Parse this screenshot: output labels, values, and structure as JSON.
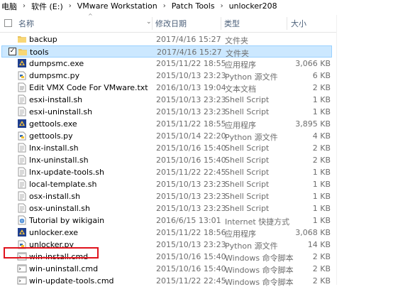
{
  "breadcrumb": [
    "电脑",
    "软件 (E:)",
    "VMware Workstation",
    "Patch Tools",
    "unlocker208"
  ],
  "columns": {
    "name": "名称",
    "date": "修改日期",
    "type": "类型",
    "size": "大小"
  },
  "files": [
    {
      "name": "backup",
      "date": "2017/4/16 15:27",
      "type": "文件夹",
      "size": "",
      "icon": "folder"
    },
    {
      "name": "tools",
      "date": "2017/4/16 15:27",
      "type": "文件夹",
      "size": "",
      "icon": "folder",
      "selected": true
    },
    {
      "name": "dumpsmc.exe",
      "date": "2015/11/22 18:55",
      "type": "应用程序",
      "size": "3,066 KB",
      "icon": "exe"
    },
    {
      "name": "dumpsmc.py",
      "date": "2015/10/13 23:23",
      "type": "Python 源文件",
      "size": "6 KB",
      "icon": "py"
    },
    {
      "name": "Edit VMX Code For VMware.txt",
      "date": "2016/10/13 19:04",
      "type": "文本文档",
      "size": "2 KB",
      "icon": "txt"
    },
    {
      "name": "esxi-install.sh",
      "date": "2015/10/13 23:23",
      "type": "Shell Script",
      "size": "1 KB",
      "icon": "sh"
    },
    {
      "name": "esxi-uninstall.sh",
      "date": "2015/10/13 23:23",
      "type": "Shell Script",
      "size": "1 KB",
      "icon": "sh"
    },
    {
      "name": "gettools.exe",
      "date": "2015/11/22 18:55",
      "type": "应用程序",
      "size": "3,895 KB",
      "icon": "exe"
    },
    {
      "name": "gettools.py",
      "date": "2015/10/14 22:20",
      "type": "Python 源文件",
      "size": "4 KB",
      "icon": "py"
    },
    {
      "name": "lnx-install.sh",
      "date": "2015/10/16 15:40",
      "type": "Shell Script",
      "size": "2 KB",
      "icon": "sh"
    },
    {
      "name": "lnx-uninstall.sh",
      "date": "2015/10/16 15:40",
      "type": "Shell Script",
      "size": "2 KB",
      "icon": "sh"
    },
    {
      "name": "lnx-update-tools.sh",
      "date": "2015/11/22 22:45",
      "type": "Shell Script",
      "size": "1 KB",
      "icon": "sh"
    },
    {
      "name": "local-template.sh",
      "date": "2015/10/13 23:23",
      "type": "Shell Script",
      "size": "1 KB",
      "icon": "sh"
    },
    {
      "name": "osx-install.sh",
      "date": "2015/10/13 23:23",
      "type": "Shell Script",
      "size": "1 KB",
      "icon": "sh"
    },
    {
      "name": "osx-uninstall.sh",
      "date": "2015/10/13 23:23",
      "type": "Shell Script",
      "size": "1 KB",
      "icon": "sh"
    },
    {
      "name": "Tutorial by wikigain",
      "date": "2016/6/15 13:01",
      "type": "Internet 快捷方式",
      "size": "1 KB",
      "icon": "url"
    },
    {
      "name": "unlocker.exe",
      "date": "2015/11/22 18:56",
      "type": "应用程序",
      "size": "3,068 KB",
      "icon": "exe"
    },
    {
      "name": "unlocker.py",
      "date": "2015/10/13 23:23",
      "type": "Python 源文件",
      "size": "14 KB",
      "icon": "py"
    },
    {
      "name": "win-install.cmd",
      "date": "2015/10/16 15:40",
      "type": "Windows 命令脚本",
      "size": "2 KB",
      "icon": "cmd"
    },
    {
      "name": "win-uninstall.cmd",
      "date": "2015/10/16 15:40",
      "type": "Windows 命令脚本",
      "size": "2 KB",
      "icon": "cmd"
    },
    {
      "name": "win-update-tools.cmd",
      "date": "2015/11/22 22:45",
      "type": "Windows 命令脚本",
      "size": "2 KB",
      "icon": "cmd"
    }
  ],
  "highlight": {
    "file": "win-install.cmd",
    "color": "#e0131d"
  },
  "colors": {
    "selection": "#cce8ff",
    "selection_border": "#99d1ff",
    "header_text": "#4c607a",
    "meta_text": "#6d6d6d"
  }
}
